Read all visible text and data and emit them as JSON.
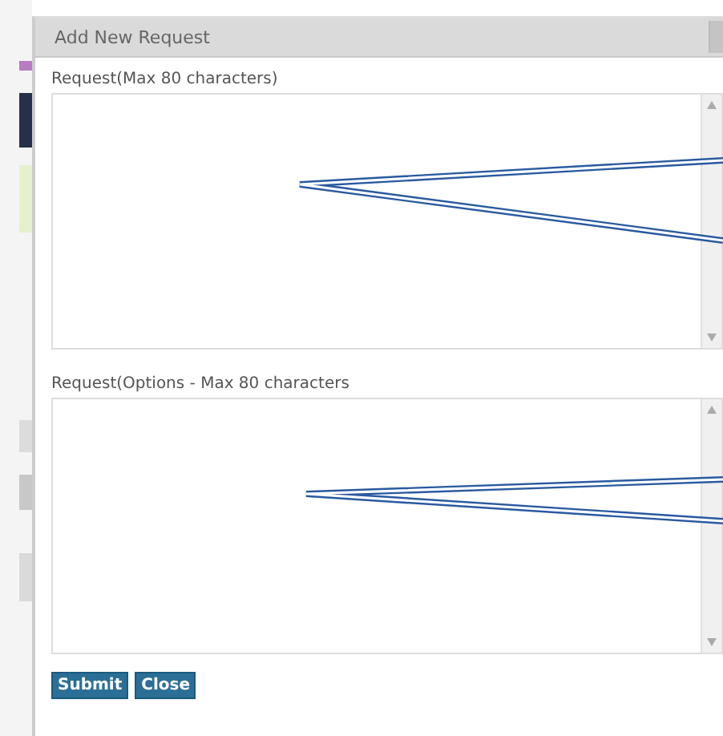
{
  "dialog": {
    "title": "Add New Request",
    "fields": [
      {
        "label": "Request(Max 80 characters)"
      },
      {
        "label": "Request(Options - Max 80 characters"
      }
    ],
    "buttons": [
      "Submit",
      "Close"
    ]
  }
}
